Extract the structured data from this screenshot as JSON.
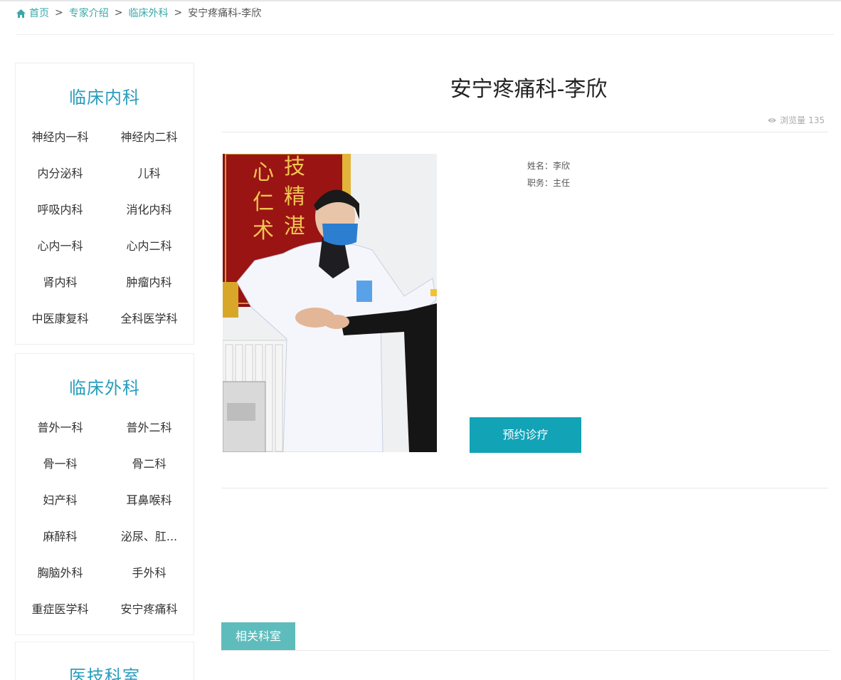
{
  "breadcrumb": {
    "home": "首页",
    "experts": "专家介绍",
    "department": "临床外科",
    "current": "安宁疼痛科-李欣",
    "separator": ">"
  },
  "sidebar": {
    "internal": {
      "title": "临床内科",
      "items": [
        "神经内一科",
        "神经内二科",
        "内分泌科",
        "儿科",
        "呼吸内科",
        "消化内科",
        "心内一科",
        "心内二科",
        "肾内科",
        "肿瘤内科",
        "中医康复科",
        "全科医学科"
      ]
    },
    "surgical": {
      "title": "临床外科",
      "items": [
        "普外一科",
        "普外二科",
        "骨一科",
        "骨二科",
        "妇产科",
        "耳鼻喉科",
        "麻醉科",
        "泌尿、肛...",
        "胸脑外科",
        "手外科",
        "重症医学科",
        "安宁疼痛科"
      ]
    },
    "tech": {
      "title": "医技科室"
    }
  },
  "doctor": {
    "title": "安宁疼痛科-李欣",
    "views_label": "浏览量",
    "views_count": "135",
    "name_line": "姓名：李欣",
    "position_line": "职务：主任",
    "book_label": "预约诊疗"
  },
  "related": {
    "tab_label": "相关科室"
  },
  "colors": {
    "accent_link": "#3aa8a8",
    "heading_blue": "#2a9dbd",
    "button_teal": "#12a3b7",
    "tab_teal": "#5fbcbc"
  },
  "icons": {
    "home": "home-icon",
    "views": "eye-icon"
  },
  "photo": {
    "banner_characters": [
      "心",
      "仁",
      "术",
      "技",
      "精",
      "湛"
    ]
  }
}
